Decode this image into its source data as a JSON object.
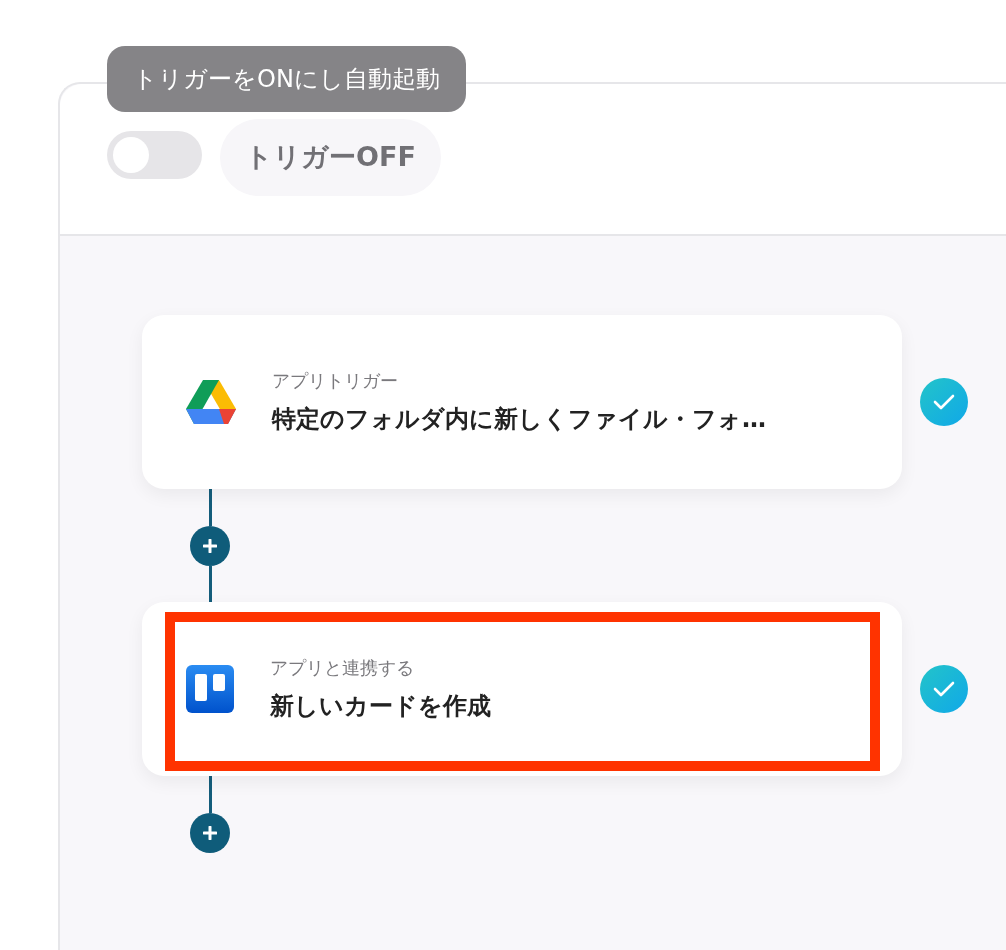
{
  "header": {
    "tooltip": "トリガーをONにし自動起動",
    "toggle": {
      "on": false
    },
    "status": "トリガーOFF"
  },
  "steps": [
    {
      "kind": "trigger",
      "label": "アプリトリガー",
      "title": "特定のフォルダ内に新しくファイル・フォ…",
      "done": true,
      "highlighted": false
    },
    {
      "kind": "action",
      "label": "アプリと連携する",
      "title": "新しいカードを作成",
      "done": true,
      "highlighted": true
    }
  ]
}
